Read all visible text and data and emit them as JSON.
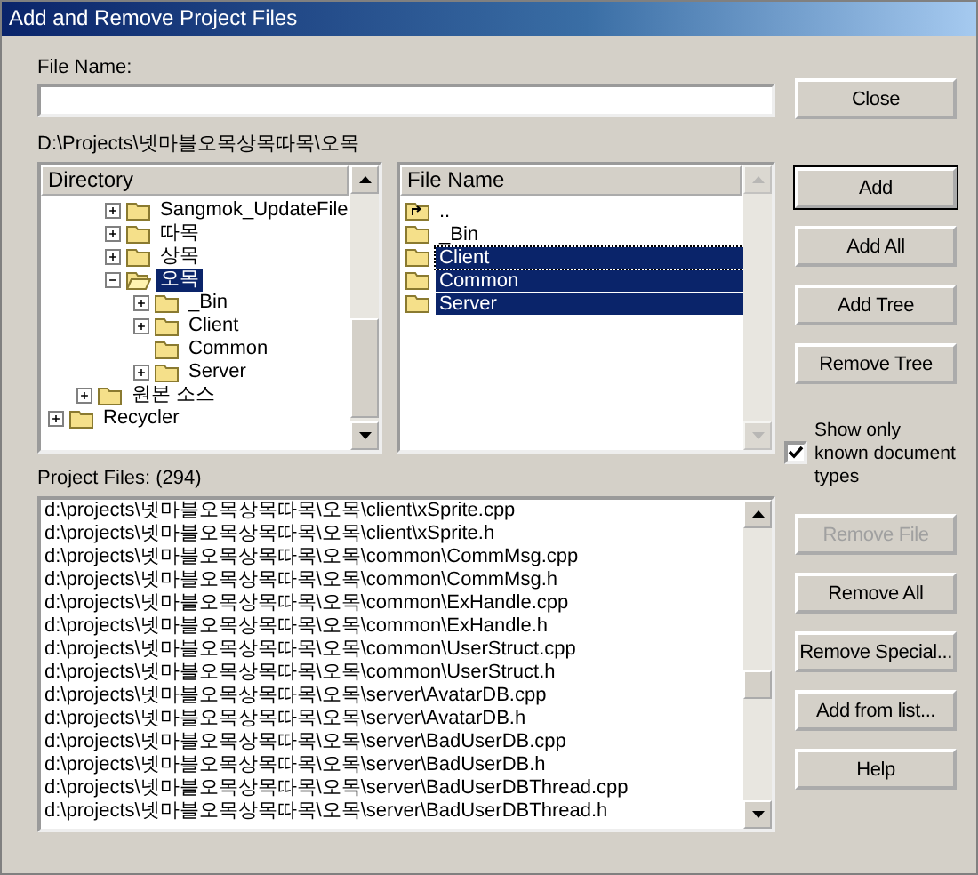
{
  "window": {
    "title": "Add and Remove Project Files"
  },
  "file_name": {
    "label": "File Name:"
  },
  "current_path": "D:\\Projects\\넷마블오목상목따목\\오목",
  "directory": {
    "header": "Directory",
    "tree": [
      {
        "children": [
          {
            "children": [
              {
                "label": "Sangmok_UpdateFile",
                "kind": "branch",
                "expanded": false,
                "selected": false
              },
              {
                "label": "따목",
                "kind": "branch",
                "expanded": false,
                "selected": false
              },
              {
                "label": "상목",
                "kind": "branch",
                "expanded": false,
                "selected": false
              },
              {
                "label": "오목",
                "kind": "branch",
                "expanded": true,
                "selected": true,
                "children": [
                  {
                    "label": "_Bin",
                    "kind": "branch",
                    "expanded": false,
                    "selected": false
                  },
                  {
                    "label": "Client",
                    "kind": "branch",
                    "expanded": false,
                    "selected": false
                  },
                  {
                    "label": "Common",
                    "kind": "leaf",
                    "selected": false
                  },
                  {
                    "label": "Server",
                    "kind": "branch",
                    "expanded": false,
                    "selected": false
                  }
                ]
              }
            ]
          },
          {
            "label": "원본 소스",
            "kind": "branch",
            "expanded": false,
            "selected": false
          }
        ]
      },
      {
        "label": "Recycler",
        "kind": "branch",
        "expanded": false,
        "selected": false
      }
    ]
  },
  "files": {
    "header": "File Name",
    "items": [
      {
        "label": "..",
        "kind": "parent",
        "selected": false
      },
      {
        "label": "_Bin",
        "kind": "folder",
        "selected": false
      },
      {
        "label": "Client",
        "kind": "folder",
        "selected": true
      },
      {
        "label": "Common",
        "kind": "folder",
        "selected": true
      },
      {
        "label": "Server",
        "kind": "folder",
        "selected": true
      }
    ]
  },
  "project_files": {
    "label": "Project Files: (294)",
    "items": [
      "d:\\projects\\넷마블오목상목따목\\오목\\client\\xSprite.cpp",
      "d:\\projects\\넷마블오목상목따목\\오목\\client\\xSprite.h",
      "d:\\projects\\넷마블오목상목따목\\오목\\common\\CommMsg.cpp",
      "d:\\projects\\넷마블오목상목따목\\오목\\common\\CommMsg.h",
      "d:\\projects\\넷마블오목상목따목\\오목\\common\\ExHandle.cpp",
      "d:\\projects\\넷마블오목상목따목\\오목\\common\\ExHandle.h",
      "d:\\projects\\넷마블오목상목따목\\오목\\common\\UserStruct.cpp",
      "d:\\projects\\넷마블오목상목따목\\오목\\common\\UserStruct.h",
      "d:\\projects\\넷마블오목상목따목\\오목\\server\\AvatarDB.cpp",
      "d:\\projects\\넷마블오목상목따목\\오목\\server\\AvatarDB.h",
      "d:\\projects\\넷마블오목상목따목\\오목\\server\\BadUserDB.cpp",
      "d:\\projects\\넷마블오목상목따목\\오목\\server\\BadUserDB.h",
      "d:\\projects\\넷마블오목상목따목\\오목\\server\\BadUserDBThread.cpp",
      "d:\\projects\\넷마블오목상목따목\\오목\\server\\BadUserDBThread.h"
    ]
  },
  "buttons": [
    {
      "label": "Close",
      "kind": "button",
      "default": false,
      "disabled": false
    },
    {
      "label": "Add",
      "kind": "button",
      "default": true,
      "disabled": false
    },
    {
      "label": "Add All",
      "kind": "button",
      "default": false,
      "disabled": false
    },
    {
      "label": "Add Tree",
      "kind": "button",
      "default": false,
      "disabled": false
    },
    {
      "label": "Remove Tree",
      "kind": "button",
      "default": false,
      "disabled": false
    },
    {
      "label": "Show only known document types",
      "kind": "checkbox",
      "checked": true
    },
    {
      "label": "Remove File",
      "kind": "button",
      "default": false,
      "disabled": true
    },
    {
      "label": "Remove All",
      "kind": "button",
      "default": false,
      "disabled": false
    },
    {
      "label": "Remove Special...",
      "kind": "button",
      "default": false,
      "disabled": false
    },
    {
      "label": "Add from list...",
      "kind": "button",
      "default": false,
      "disabled": false
    },
    {
      "label": "Help",
      "kind": "button",
      "default": false,
      "disabled": false
    }
  ]
}
